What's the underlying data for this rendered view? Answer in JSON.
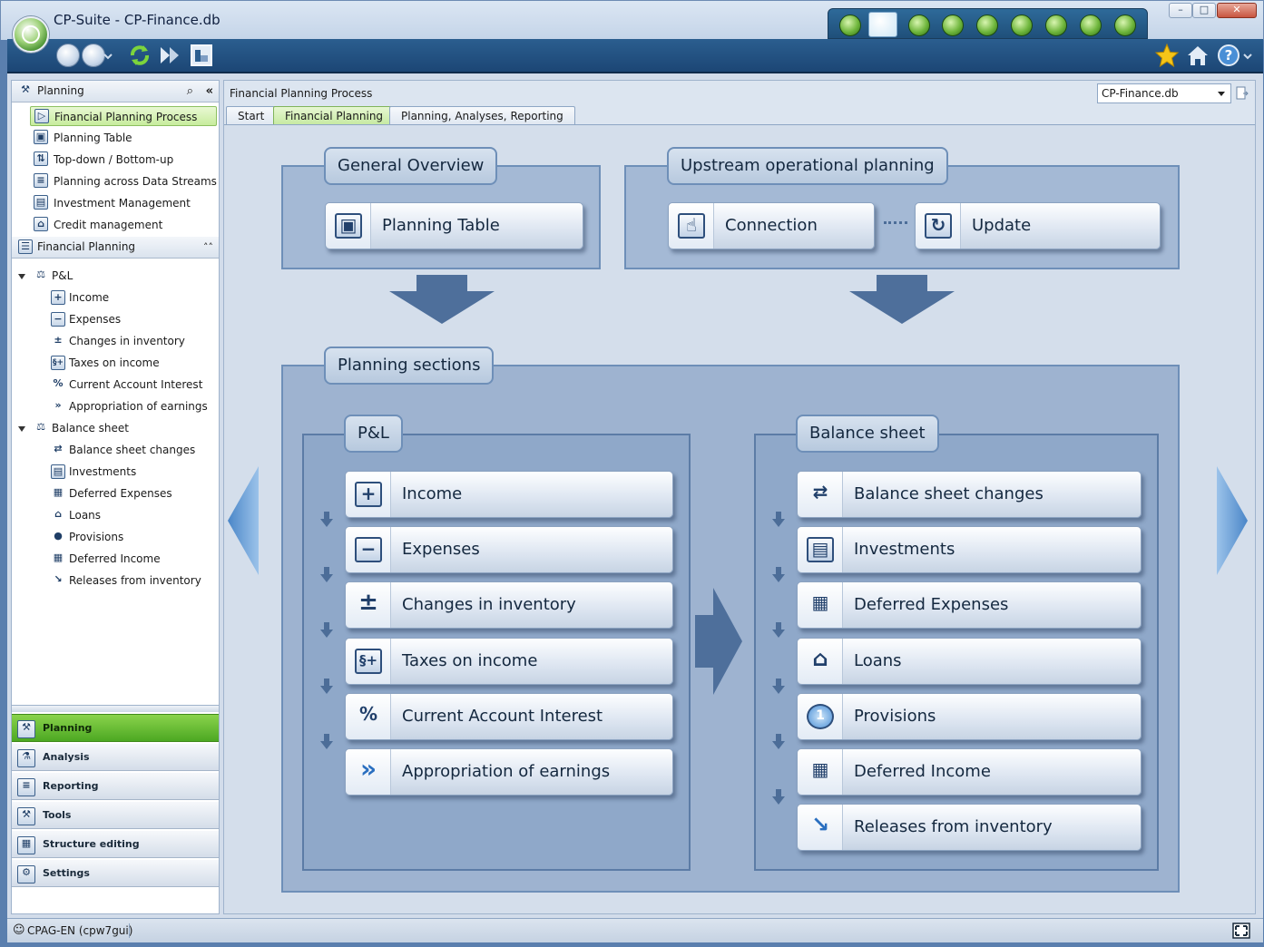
{
  "window": {
    "title": "CP-Suite - CP-Finance.db",
    "controls": {
      "minimize": "–",
      "maximize": "□",
      "close": "✕"
    }
  },
  "modules": [
    "module-1-icon",
    "module-2-icon",
    "module-3-icon",
    "module-4-icon",
    "module-5-icon",
    "module-6-icon",
    "module-7-icon",
    "module-8-icon",
    "module-9-icon"
  ],
  "toolbar": {
    "icons": [
      "back-icon",
      "forward-icon",
      "refresh-icon",
      "next-icon",
      "planning-table-icon"
    ],
    "right_icons": [
      "favorites-star-icon",
      "home-icon",
      "help-icon"
    ]
  },
  "sidebar": {
    "planning_header": "Planning",
    "items": [
      {
        "label": "Financial Planning Process",
        "icon": "process-icon",
        "selected": true
      },
      {
        "label": "Planning Table",
        "icon": "table-icon"
      },
      {
        "label": "Top-down / Bottom-up",
        "icon": "topdown-icon"
      },
      {
        "label": "Planning across Data Streams",
        "icon": "streams-icon"
      },
      {
        "label": "Investment Management",
        "icon": "investment-icon"
      },
      {
        "label": "Credit management",
        "icon": "bank-icon"
      }
    ],
    "fp_header": "Financial Planning",
    "tree": {
      "pl": {
        "label": "P&L",
        "children": [
          "Income",
          "Expenses",
          "Changes in inventory",
          "Taxes on income",
          "Current Account Interest",
          "Appropriation of earnings"
        ]
      },
      "bs": {
        "label": "Balance sheet",
        "children": [
          "Balance sheet changes",
          "Investments",
          "Deferred Expenses",
          "Loans",
          "Provisions",
          "Deferred Income",
          "Releases from inventory"
        ]
      }
    },
    "nav": [
      {
        "label": "Planning",
        "selected": true
      },
      {
        "label": "Analysis"
      },
      {
        "label": "Reporting"
      },
      {
        "label": "Tools"
      },
      {
        "label": "Structure editing"
      },
      {
        "label": "Settings"
      }
    ]
  },
  "content": {
    "breadcrumb": "Financial Planning Process",
    "db_select": "CP-Finance.db",
    "tabs": [
      "Start",
      "Financial Planning",
      "Planning, Analyses, Reporting"
    ],
    "active_tab": 1,
    "general_overview": {
      "title": "General Overview",
      "button": "Planning Table"
    },
    "upstream": {
      "title": "Upstream operational planning",
      "connection": "Connection",
      "update": "Update"
    },
    "planning_sections": {
      "title": "Planning sections",
      "pl": {
        "title": "P&L",
        "buttons": [
          "Income",
          "Expenses",
          "Changes in inventory",
          "Taxes on income",
          "Current Account Interest",
          "Appropriation of earnings"
        ]
      },
      "bs": {
        "title": "Balance sheet",
        "buttons": [
          "Balance sheet changes",
          "Investments",
          "Deferred Expenses",
          "Loans",
          "Provisions",
          "Deferred Income",
          "Releases from inventory"
        ]
      }
    }
  },
  "status": {
    "user": "CPAG-EN (cpw7gui)"
  },
  "colors": {
    "accent_green": "#7cc63f",
    "frame_blue": "#1f4f7a",
    "panel_blue": "#a4b9d5"
  }
}
